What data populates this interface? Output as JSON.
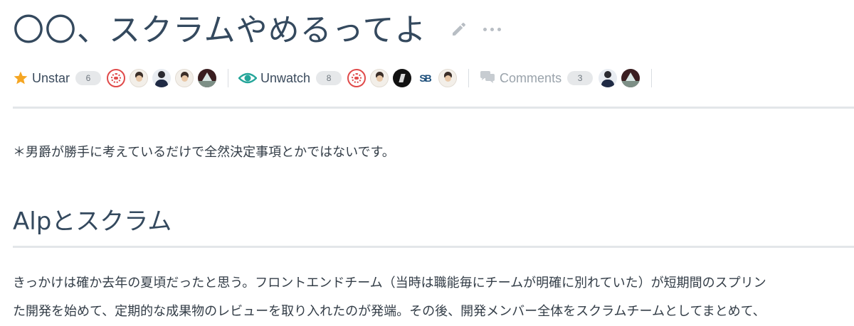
{
  "article": {
    "title": "〇〇、スクラムやめるってよ"
  },
  "meta": {
    "star": {
      "label": "Unstar",
      "count": "6"
    },
    "watch": {
      "label": "Unwatch",
      "count": "8"
    },
    "comments": {
      "label": "Comments",
      "count": "3"
    }
  },
  "content": {
    "notice": "＊男爵が勝手に考えているだけで全然決定事項とかではないです。",
    "section_heading": "Alpとスクラム",
    "paragraph_lines": [
      "きっかけは確か去年の夏頃だったと思う。フロントエンドチーム（当時は職能毎にチームが明確に別れていた）が短期間のスプリン",
      "た開発を始めて、定期的な成果物のレビューを取り入れたのが発端。その後、開発メンバー全体をスクラムチームとしてまとめて、"
    ]
  },
  "colors": {
    "star": "#f5a623",
    "watch": "#26a69a",
    "text": "#34495e",
    "muted": "#9aa3ab"
  }
}
